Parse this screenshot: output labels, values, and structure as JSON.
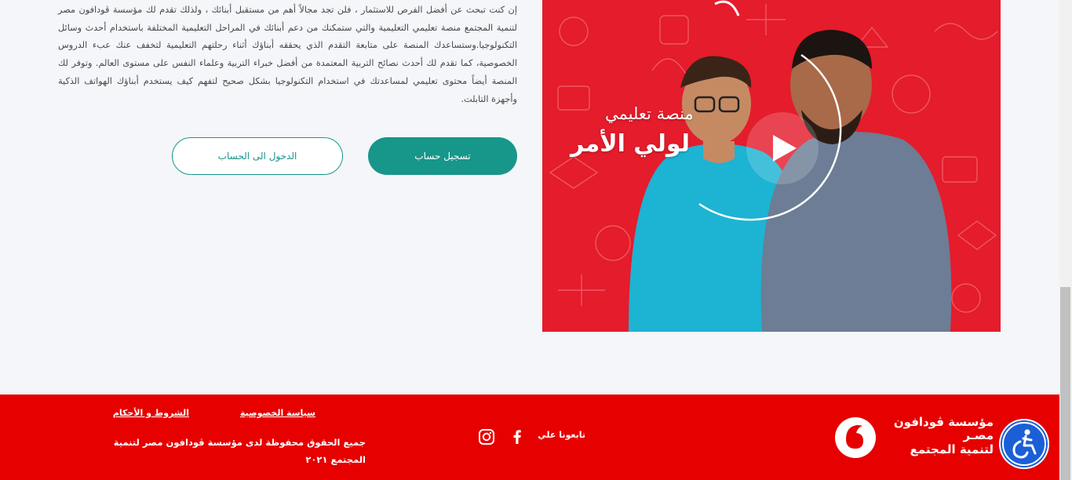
{
  "main": {
    "intro_text": "إن كنت تبحث عن أفضل الفرص للاستثمار ، فلن تجد مجالاً أهم من مستقبل أبنائك ، ولذلك تقدم لك مؤسسة ڤودافون مصر لتنمية المجتمع منصة تعليمي التعليمية والتي ستمكنك من دعم أبنائك في المراحل التعليمية المختلفة باستخدام أحدث وسائل التكنولوجيا.وستساعدك المنصة على متابعة التقدم الذي يحققه أبناؤك أثناء رحلتهم التعليمية لتخفف عنك عبء الدروس الخصوصية، كما تقدم لك أحدث نصائح التربية المعتمدة من أفضل خبراء التربية وعلماء النفس على مستوى العالم. وتوفر لك المنصة أيضاً محتوى تعليمي لمساعدتك في استخدام التكنولوجيا بشكل صحيح لتفهم كيف يستخدم أبناؤك الهواتف الذكية وأجهزة التابلت.",
    "register_label": "تسجيل حساب",
    "login_label": "الدخول الى الحساب"
  },
  "video": {
    "subtitle": "منصة تعليمي",
    "title": "لولي الأمر",
    "play_icon": "play-icon",
    "background_color": "#e41c2c"
  },
  "footer": {
    "logo_lines": [
      "مؤسسة ڤودافون",
      "مصـر",
      "لتنمية المجتمع"
    ],
    "follow_label": "تابعونا علي",
    "social_icons": [
      "facebook-icon",
      "instagram-icon"
    ],
    "privacy_link": "سياسة الخصوصية",
    "terms_link": "الشروط و الأحكام",
    "copyright": "جميع الحقوق محفوظة لدى مؤسسة ڤودافون مصر لتنمية المجتمع ٢٠٢١",
    "background_color": "#e60000"
  },
  "accessibility": {
    "icon": "accessibility-icon",
    "color": "#1b5fd6"
  },
  "colors": {
    "accent": "#17968a",
    "page_background": "#f4f6f9"
  }
}
